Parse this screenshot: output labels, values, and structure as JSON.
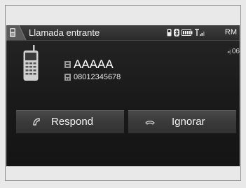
{
  "header": {
    "tab_icon": "phone-tab-icon",
    "title": "Llamada entrante",
    "status_icons": [
      "bluetooth-icon",
      "battery-icon",
      "signal-icon"
    ],
    "roaming": "RM"
  },
  "call": {
    "volume_icon": "volume-icon",
    "volume_level": "06",
    "caller_name": "AAAAA",
    "caller_number": "08012345678"
  },
  "actions": {
    "answer_label": "Respond",
    "ignore_label": "Ignorar",
    "answer_icon": "pickup-icon",
    "ignore_icon": "hangup-icon"
  },
  "colors": {
    "screen_bg": "#1b1b1b",
    "button_bg": "#3a3a3a",
    "text": "#f4f4f4"
  }
}
